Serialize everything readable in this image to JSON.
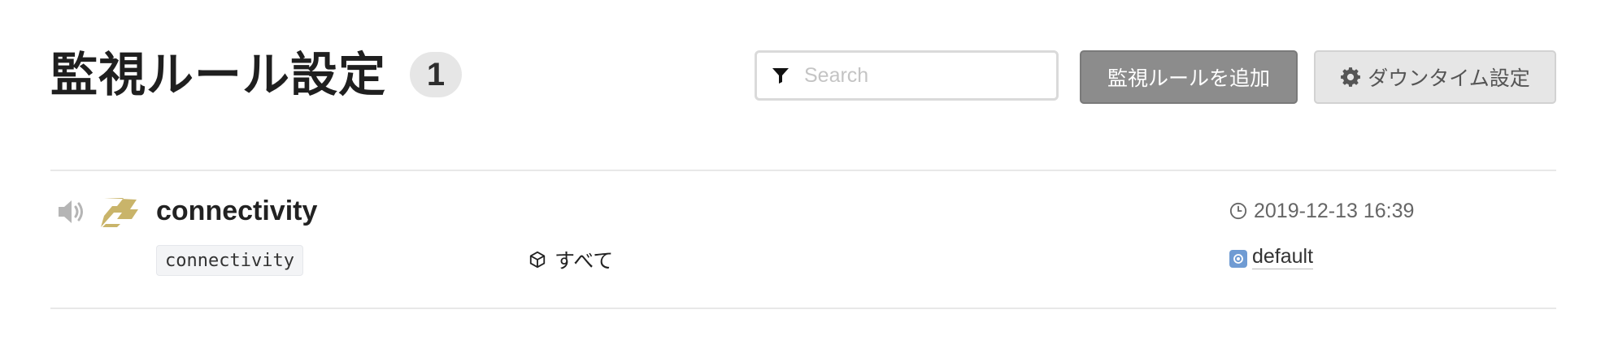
{
  "header": {
    "title": "監視ルール設定",
    "count": "1",
    "search_placeholder": "Search",
    "search_value": "",
    "add_button_label": "監視ルールを追加",
    "downtime_button_label": "ダウンタイム設定"
  },
  "monitors": [
    {
      "name": "connectivity",
      "metric": "connectivity",
      "scope": "すべて",
      "updated_at": "2019-12-13 16:39",
      "notification_channel": "default",
      "muted_icon": "speaker-icon",
      "service_icon": "service-logo-icon"
    }
  ],
  "colors": {
    "add_button_bg": "#8c8c8c",
    "downtime_button_bg": "#e6e6e6",
    "channel_icon": "#6f9bd3",
    "service_logo": "#c9b46a"
  }
}
